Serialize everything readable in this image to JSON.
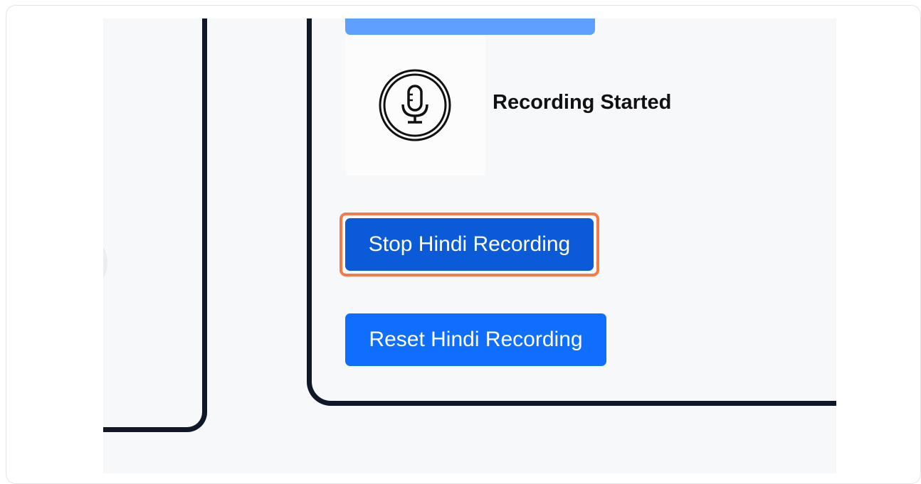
{
  "recorder": {
    "status_text": "Recording Started",
    "mic_icon": "microphone-icon",
    "stop_button_label": "Stop Hindi Recording",
    "reset_button_label": "Reset Hindi Recording"
  },
  "colors": {
    "stop_button": "#0b5ad7",
    "reset_button": "#0f6efd",
    "highlight": "#f47b47",
    "panel_border": "#0f1729"
  }
}
